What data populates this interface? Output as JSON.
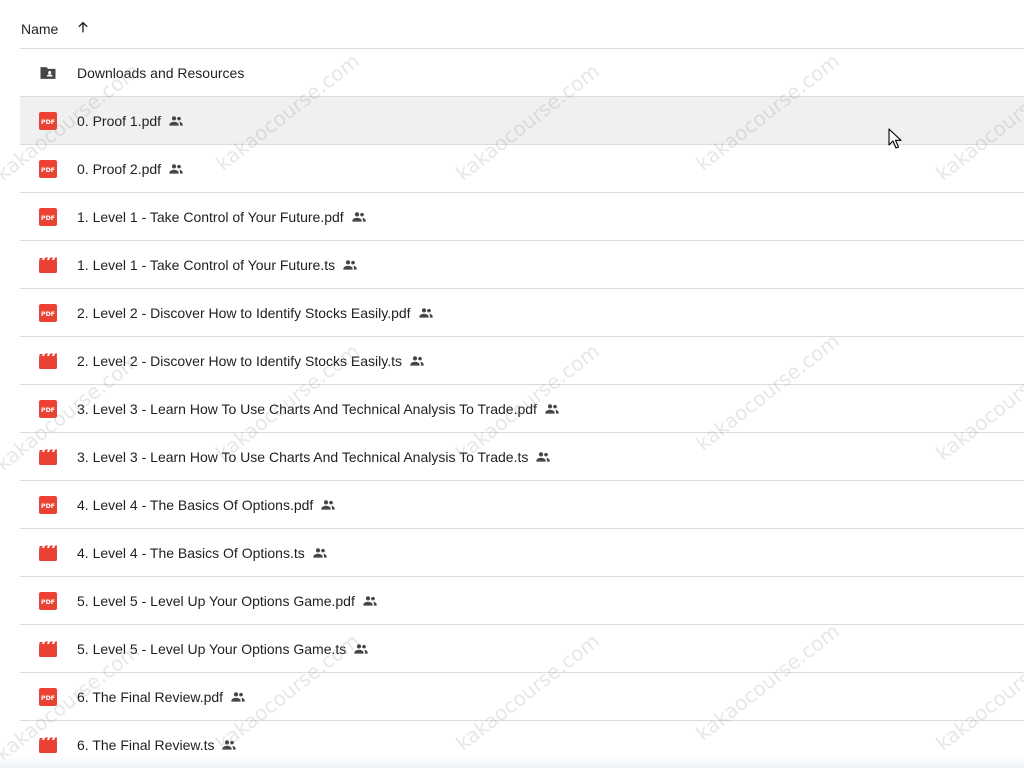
{
  "header": {
    "name_label": "Name",
    "sort_icon": "arrow-upward-icon",
    "sort_direction": "ascending"
  },
  "files": [
    {
      "name": "Downloads and Resources",
      "type": "folder",
      "icon": "shared-folder-icon",
      "shared": false
    },
    {
      "name": "0. Proof 1.pdf",
      "type": "pdf",
      "icon": "pdf-icon",
      "shared": true
    },
    {
      "name": "0. Proof 2.pdf",
      "type": "pdf",
      "icon": "pdf-icon",
      "shared": true
    },
    {
      "name": "1. Level 1 - Take Control of Your Future.pdf",
      "type": "pdf",
      "icon": "pdf-icon",
      "shared": true
    },
    {
      "name": "1. Level 1 - Take Control of Your Future.ts",
      "type": "video",
      "icon": "video-icon",
      "shared": true
    },
    {
      "name": "2. Level 2 - Discover How to Identify Stocks Easily.pdf",
      "type": "pdf",
      "icon": "pdf-icon",
      "shared": true
    },
    {
      "name": "2. Level 2 - Discover How to Identify Stocks Easily.ts",
      "type": "video",
      "icon": "video-icon",
      "shared": true
    },
    {
      "name": "3. Level 3 - Learn How To Use Charts And Technical Analysis To Trade.pdf",
      "type": "pdf",
      "icon": "pdf-icon",
      "shared": true
    },
    {
      "name": "3. Level 3 - Learn How To Use Charts And Technical Analysis To Trade.ts",
      "type": "video",
      "icon": "video-icon",
      "shared": true
    },
    {
      "name": "4. Level 4 - The Basics Of Options.pdf",
      "type": "pdf",
      "icon": "pdf-icon",
      "shared": true
    },
    {
      "name": "4. Level 4 - The Basics Of Options.ts",
      "type": "video",
      "icon": "video-icon",
      "shared": true
    },
    {
      "name": "5. Level 5 - Level Up Your Options Game.pdf",
      "type": "pdf",
      "icon": "pdf-icon",
      "shared": true
    },
    {
      "name": "5. Level 5 - Level Up Your Options Game.ts",
      "type": "video",
      "icon": "video-icon",
      "shared": true
    },
    {
      "name": "6. The Final Review.pdf",
      "type": "pdf",
      "icon": "pdf-icon",
      "shared": true
    },
    {
      "name": "6. The Final Review.ts",
      "type": "video",
      "icon": "video-icon",
      "shared": true
    }
  ],
  "hovered_row_index": 1,
  "shared_icon": "people-icon",
  "pdf_badge_text": "PDF",
  "watermark_text": "kakaocourse.com",
  "colors": {
    "pdf_red": "#ea4335",
    "video_red": "#ea4335",
    "folder_gray": "#444746",
    "text": "#1f1f1f",
    "divider": "#dadce0",
    "hover_bg": "#f0f0f0"
  }
}
